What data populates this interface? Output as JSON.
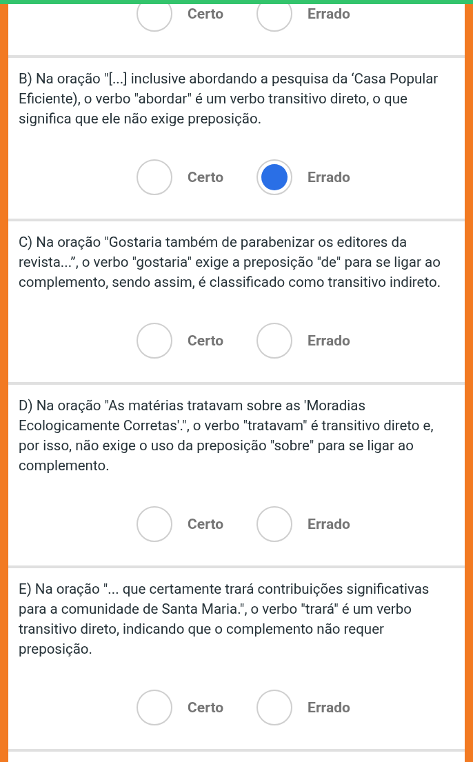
{
  "questions": [
    {
      "options": [
        {
          "label": "Certo",
          "selected": false
        },
        {
          "label": "Errado",
          "selected": false
        }
      ]
    },
    {
      "text": "B) Na oração \"[...] inclusive abordando a pesquisa da ‘Casa Popular Eficiente), o verbo ″abordar″ é um verbo transitivo direto, o que significa que ele não exige preposição.",
      "options": [
        {
          "label": "Certo",
          "selected": false
        },
        {
          "label": "Errado",
          "selected": true
        }
      ]
    },
    {
      "text": "C) Na oração \"Gostaria também de parabenizar os editores da revista...”, o verbo \"gostaria\" exige a preposição \"de\" para se ligar ao complemento, sendo assim, é classificado como transitivo indireto.",
      "options": [
        {
          "label": "Certo",
          "selected": false
        },
        {
          "label": "Errado",
          "selected": false
        }
      ]
    },
    {
      "text": "D) Na oração \"As matérias tratavam sobre as 'Moradias Ecologicamente Corretas'.\", o verbo \"tratavam\" é transitivo direto e, por isso, não exige o uso da preposição \"sobre\" para se ligar ao complemento.",
      "options": [
        {
          "label": "Certo",
          "selected": false
        },
        {
          "label": "Errado",
          "selected": false
        }
      ]
    },
    {
      "text": "E) Na oração \"... que certamente trará contribuições significativas para a comunidade de Santa Maria.\", o verbo \"trará\" é um verbo transitivo direto, indicando que o complemento não requer preposição.",
      "options": [
        {
          "label": "Certo",
          "selected": false
        },
        {
          "label": "Errado",
          "selected": false
        }
      ]
    }
  ]
}
